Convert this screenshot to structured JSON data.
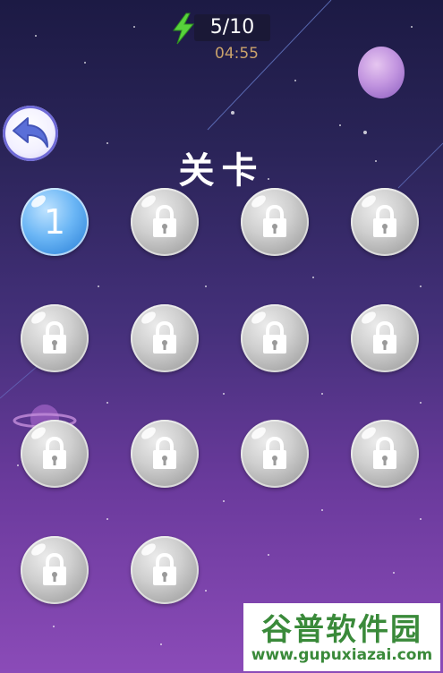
{
  "hud": {
    "energy_icon": "lightning-bolt-icon",
    "energy_count": "5/10",
    "timer": "04:55"
  },
  "back_button": {
    "icon": "back-arrow-icon"
  },
  "title": "关卡",
  "levels": [
    {
      "label": "1",
      "locked": false
    },
    {
      "label": "",
      "locked": true
    },
    {
      "label": "",
      "locked": true
    },
    {
      "label": "",
      "locked": true
    },
    {
      "label": "",
      "locked": true
    },
    {
      "label": "",
      "locked": true
    },
    {
      "label": "",
      "locked": true
    },
    {
      "label": "",
      "locked": true
    },
    {
      "label": "",
      "locked": true
    },
    {
      "label": "",
      "locked": true
    },
    {
      "label": "",
      "locked": true
    },
    {
      "label": "",
      "locked": true
    },
    {
      "label": "",
      "locked": true
    },
    {
      "label": "",
      "locked": true
    }
  ],
  "watermark": {
    "name": "谷普软件园",
    "url": "www.gupuxiazai.com"
  },
  "colors": {
    "energy": "#58d23c",
    "timer": "#c9a26b",
    "unlocked_level": "#4a9be8",
    "locked_level": "#bdbdbd",
    "watermark": "#3a8a3a"
  }
}
